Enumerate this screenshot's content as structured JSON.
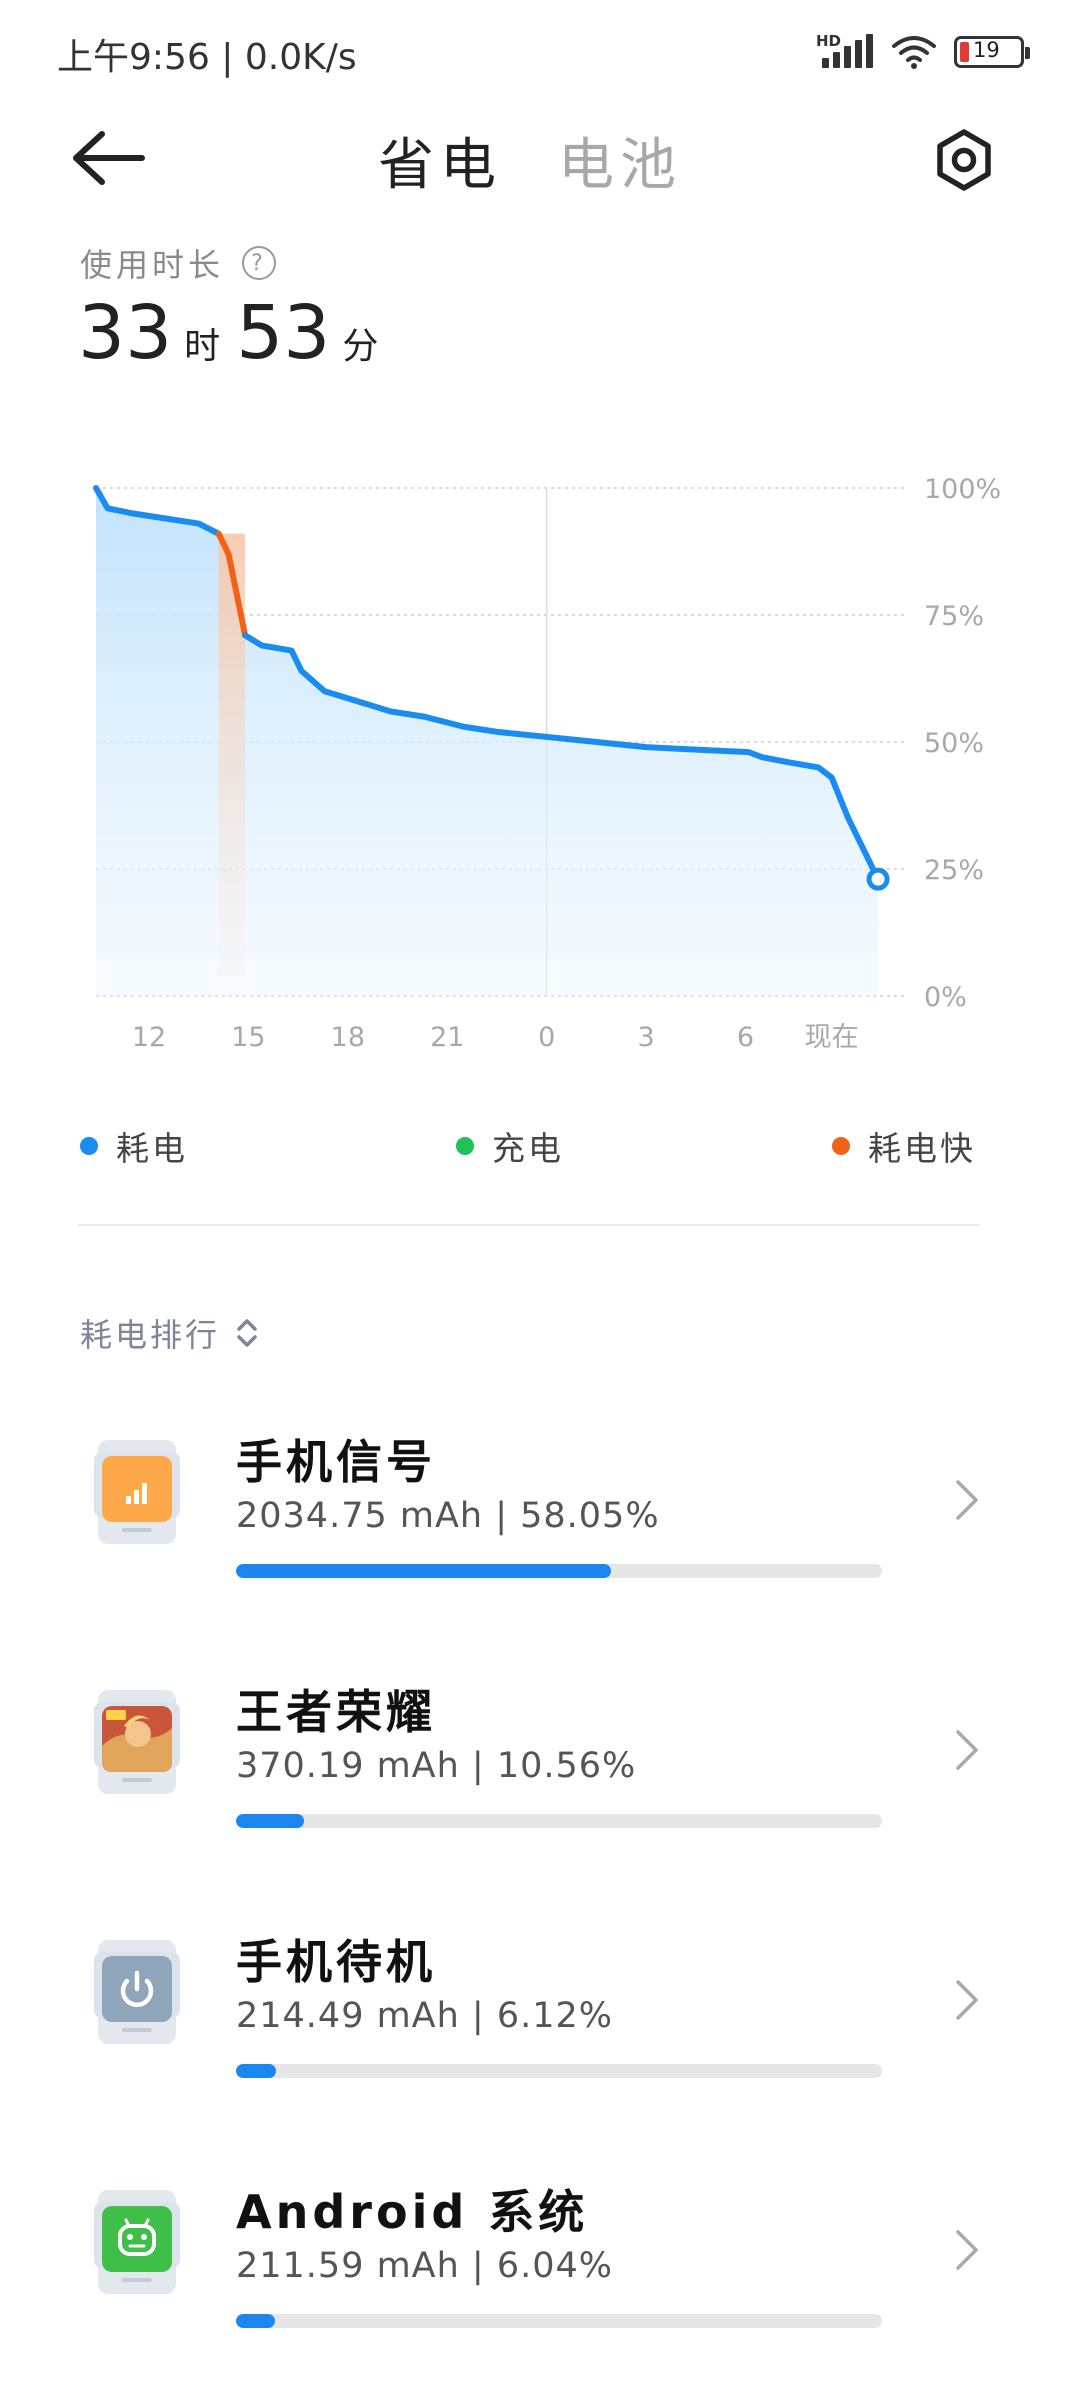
{
  "status_bar": {
    "time_speed": "上午9:56 | 0.0K/s",
    "network_badge": "HD",
    "battery_level": "19",
    "icons": [
      "hd-signal-icon",
      "wifi-icon",
      "battery-icon"
    ]
  },
  "header": {
    "back_icon": "back-arrow-icon",
    "tabs": [
      {
        "label": "省电",
        "active": true
      },
      {
        "label": "电池",
        "active": false
      }
    ],
    "settings_icon": "settings-gear-icon"
  },
  "usage": {
    "label": "使用时长",
    "hours": "33",
    "hours_unit": "时",
    "minutes": "53",
    "minutes_unit": "分"
  },
  "chart_data": {
    "type": "area",
    "y_tick_labels": [
      "100%",
      "75%",
      "50%",
      "25%",
      "0%"
    ],
    "x_tick_labels": [
      "12",
      "15",
      "18",
      "21",
      "0",
      "3",
      "6",
      "现在"
    ],
    "x_hours_tick_positions": [
      12,
      15,
      18,
      21,
      24,
      27,
      30,
      32.6
    ],
    "ylim": [
      0,
      100
    ],
    "xlim": [
      10.4,
      34.3
    ],
    "series": [
      {
        "name": "耗电",
        "color": "#1a8cf0",
        "x": [
          10.4,
          10.75,
          11.5,
          12.5,
          13.5,
          14.1
        ],
        "y": [
          100,
          96,
          95,
          94,
          93,
          91
        ]
      },
      {
        "name": "耗电快",
        "color": "#f06218",
        "x": [
          14.1,
          14.4,
          14.9
        ],
        "y": [
          91,
          87,
          71
        ]
      },
      {
        "name": "耗电",
        "color": "#1a8cf0",
        "x": [
          14.9,
          15.4,
          16.3,
          16.6,
          17.3,
          18.3,
          19.3,
          20.3,
          21.5,
          22.5,
          24.0,
          25.5,
          27.0,
          28.5,
          30.1,
          30.5,
          31.3,
          32.2,
          32.6,
          33.1,
          34.0
        ],
        "y": [
          71,
          69,
          68,
          64,
          60,
          58,
          56,
          55,
          53,
          52,
          51,
          50,
          49,
          48.5,
          48,
          47,
          46,
          45,
          43,
          35,
          23
        ]
      }
    ],
    "fast_drain_band": [
      14.1,
      14.9
    ],
    "divider_x": 24.0,
    "end_point": {
      "x": 34.0,
      "y": 23
    },
    "grid": true
  },
  "legend": [
    {
      "label": "耗电",
      "color": "#1a8cf0"
    },
    {
      "label": "充电",
      "color": "#1ec15a"
    },
    {
      "label": "耗电快",
      "color": "#f06218"
    }
  ],
  "ranking": {
    "header": "耗电排行",
    "sort_icon": "sort-updown-icon",
    "items": [
      {
        "name": "手机信号",
        "stats": "2034.75 mAh | 58.05%",
        "percent": 58.05,
        "icon": "signal-app-icon"
      },
      {
        "name": "王者荣耀",
        "stats": "370.19 mAh | 10.56%",
        "percent": 10.56,
        "icon": "game-app-icon"
      },
      {
        "name": "手机待机",
        "stats": "214.49 mAh | 6.12%",
        "percent": 6.12,
        "icon": "standby-power-icon"
      },
      {
        "name": "Android 系统",
        "stats": "211.59 mAh | 6.04%",
        "percent": 6.04,
        "icon": "android-system-icon"
      }
    ]
  }
}
